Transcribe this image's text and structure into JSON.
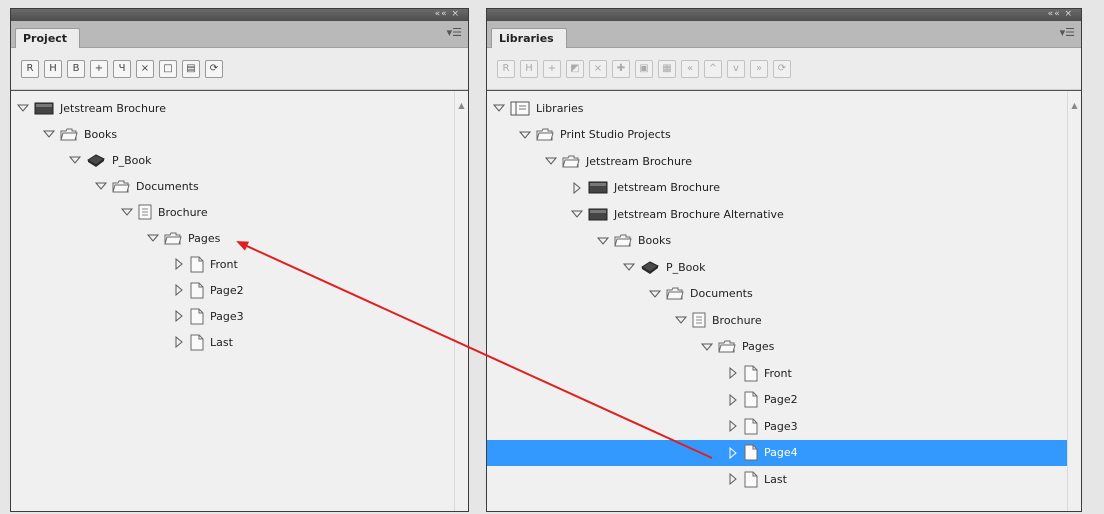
{
  "project_panel": {
    "collapse": "«« ×",
    "tab": "Project",
    "menu": "▾☰",
    "toolbar": [
      "R",
      "H",
      "B",
      "+",
      "Ч",
      "×",
      "□",
      "▤",
      "⟳"
    ],
    "tree": [
      {
        "label": "Jetstream Brochure",
        "level": 0,
        "icon": "brochure-dark-icon",
        "state": "expanded"
      },
      {
        "label": "Books",
        "level": 1,
        "icon": "folder-icon",
        "state": "expanded"
      },
      {
        "label": "P_Book",
        "level": 2,
        "icon": "book-icon",
        "state": "expanded"
      },
      {
        "label": "Documents",
        "level": 3,
        "icon": "folder-icon",
        "state": "expanded"
      },
      {
        "label": "Brochure",
        "level": 4,
        "icon": "document-icon",
        "state": "expanded"
      },
      {
        "label": "Pages",
        "level": 5,
        "icon": "folder-icon",
        "state": "expanded"
      },
      {
        "label": "Front",
        "level": 6,
        "icon": "page-icon",
        "state": "collapsed"
      },
      {
        "label": "Page2",
        "level": 6,
        "icon": "page-icon",
        "state": "collapsed"
      },
      {
        "label": "Page3",
        "level": 6,
        "icon": "page-icon",
        "state": "collapsed"
      },
      {
        "label": "Last",
        "level": 6,
        "icon": "page-icon",
        "state": "collapsed"
      }
    ]
  },
  "libraries_panel": {
    "collapse": "«« ×",
    "tab": "Libraries",
    "menu": "▾☰",
    "toolbar": [
      "R",
      "H",
      "+",
      "◩",
      "×",
      "✚",
      "▣",
      "▦",
      "«",
      "^",
      "v",
      "»",
      "⟳"
    ],
    "tree": [
      {
        "label": "Libraries",
        "level": 0,
        "icon": "library-icon",
        "state": "expanded"
      },
      {
        "label": "Print Studio Projects",
        "level": 1,
        "icon": "folder-icon",
        "state": "expanded"
      },
      {
        "label": "Jetstream Brochure",
        "level": 2,
        "icon": "folder-icon",
        "state": "expanded"
      },
      {
        "label": "Jetstream Brochure",
        "level": 3,
        "icon": "brochure-dark-icon",
        "state": "collapsed"
      },
      {
        "label": "Jetstream Brochure Alternative",
        "level": 3,
        "icon": "brochure-dark-icon",
        "state": "expanded"
      },
      {
        "label": "Books",
        "level": 4,
        "icon": "folder-icon",
        "state": "expanded"
      },
      {
        "label": "P_Book",
        "level": 5,
        "icon": "book-icon",
        "state": "expanded"
      },
      {
        "label": "Documents",
        "level": 6,
        "icon": "folder-icon",
        "state": "expanded"
      },
      {
        "label": "Brochure",
        "level": 7,
        "icon": "document-icon",
        "state": "expanded"
      },
      {
        "label": "Pages",
        "level": 8,
        "icon": "folder-icon",
        "state": "expanded"
      },
      {
        "label": "Front",
        "level": 9,
        "icon": "page-icon",
        "state": "collapsed"
      },
      {
        "label": "Page2",
        "level": 9,
        "icon": "page-icon",
        "state": "collapsed"
      },
      {
        "label": "Page3",
        "level": 9,
        "icon": "page-icon",
        "state": "collapsed"
      },
      {
        "label": "Page4",
        "level": 9,
        "icon": "page-icon",
        "state": "collapsed",
        "selected": true
      },
      {
        "label": "Last",
        "level": 9,
        "icon": "page-icon",
        "state": "collapsed"
      }
    ]
  },
  "colors": {
    "selection": "#3399ff",
    "drag_arrow": "#e02020"
  }
}
